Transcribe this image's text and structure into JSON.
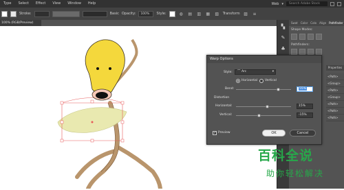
{
  "menu": {
    "items": [
      "Type",
      "Select",
      "Effect",
      "View",
      "Window",
      "Help"
    ],
    "workspace": "Web",
    "search_placeholder": "Search Adobe Stock"
  },
  "controlbar": {
    "stroke_label": "Stroke:",
    "style_value": "Basic",
    "opacity_label": "Opacity:",
    "opacity_value": "100%",
    "style_label": "Style:",
    "transform_label": "Transform"
  },
  "document": {
    "tab_label": "100% (RGB/Preview)"
  },
  "right_panel": {
    "tabs": [
      "Swat",
      "Color",
      "Colo",
      "Align",
      "Pathfinder"
    ],
    "shape_modes_label": "Shape Modes:",
    "pathfinders_label": "Pathfinders:",
    "properties_label": "Properties",
    "layers": [
      "<Path>",
      "<Group>",
      "<Path>",
      "<Group>",
      "<Path>",
      "<Path>",
      "<Path>"
    ]
  },
  "warp_dialog": {
    "title": "Warp Options",
    "style_label": "Style:",
    "style_value": "Arc",
    "orientation": {
      "horizontal": "Horizontal",
      "vertical": "Vertical",
      "selected": "horizontal"
    },
    "bend_label": "Bend:",
    "bend_value": "55%",
    "distortion_label": "Distortion",
    "horizontal_label": "Horizontal:",
    "horizontal_value": "15%",
    "vertical_label": "Vertical:",
    "vertical_value": "-15%",
    "bend_level": 0.775,
    "horizontal_level": 0.575,
    "vertical_level": 0.425,
    "preview_label": "Preview",
    "preview_checked": true,
    "ok_label": "OK",
    "cancel_label": "Cancel"
  },
  "watermark": {
    "big": "百科全说",
    "small": "助你轻松解决"
  },
  "colors": {
    "ui_dark": "#323232",
    "panel": "#535353",
    "bulb_yellow": "#f4d83c",
    "leaf_green": "#e9e9b0",
    "stem": "#b9956c",
    "selection_red": "#e85a5a",
    "watermark_green": "#27a84a"
  }
}
